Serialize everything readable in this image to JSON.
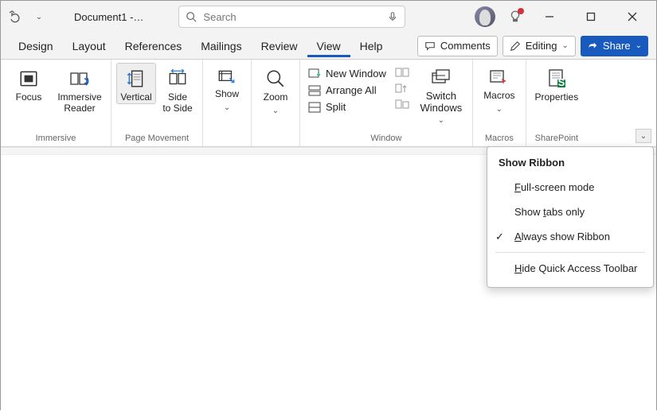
{
  "title": "Document1 -…",
  "search": {
    "placeholder": "Search"
  },
  "tabs": [
    "Design",
    "Layout",
    "References",
    "Mailings",
    "Review",
    "View",
    "Help"
  ],
  "activeTab": "View",
  "comments": "Comments",
  "editing": "Editing",
  "share": "Share",
  "groups": {
    "immersive": {
      "label": "Immersive",
      "focus": "Focus",
      "reader": "Immersive\nReader"
    },
    "pagemove": {
      "label": "Page Movement",
      "vertical": "Vertical",
      "side": "Side\nto Side"
    },
    "show": "Show",
    "zoom": "Zoom",
    "window": {
      "label": "Window",
      "new": "New Window",
      "arrange": "Arrange All",
      "split": "Split",
      "switch": "Switch\nWindows"
    },
    "macros": {
      "label": "Macros",
      "btn": "Macros"
    },
    "sp": {
      "label": "SharePoint",
      "btn": "Properties"
    }
  },
  "menu": {
    "title": "Show Ribbon",
    "full": "ull-screen mode",
    "tabs": "abs only",
    "always": "lways show Ribbon",
    "hide": "ide Quick Access Toolbar"
  }
}
